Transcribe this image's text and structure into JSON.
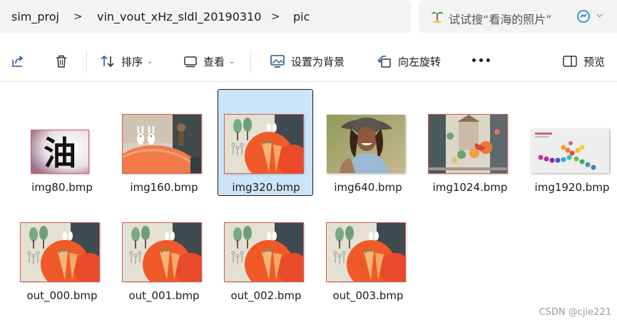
{
  "breadcrumb": {
    "items": [
      "sim_proj",
      "vin_vout_xHz_sldl_20190310",
      "pic"
    ],
    "separator": ">"
  },
  "search": {
    "placeholder": "试试搜“看海的照片”"
  },
  "toolbar": {
    "share_icon": "share-icon",
    "delete_icon": "trash-icon",
    "sort_label": "排序",
    "view_label": "查看",
    "set_background_label": "设置为背景",
    "rotate_left_label": "向左旋转",
    "more_label": "•••",
    "preview_label": "预览"
  },
  "files": [
    {
      "name": "img80.bmp",
      "kind": "oil-char"
    },
    {
      "name": "img160.bmp",
      "kind": "bunny"
    },
    {
      "name": "img320.bmp",
      "kind": "carrot",
      "selected": true
    },
    {
      "name": "img640.bmp",
      "kind": "woman"
    },
    {
      "name": "img1024.bmp",
      "kind": "scene"
    },
    {
      "name": "img1920.bmp",
      "kind": "balls"
    },
    {
      "name": "out_000.bmp",
      "kind": "carrot"
    },
    {
      "name": "out_001.bmp",
      "kind": "carrot"
    },
    {
      "name": "out_002.bmp",
      "kind": "carrot"
    },
    {
      "name": "out_003.bmp",
      "kind": "carrot"
    }
  ],
  "oil_glyph": "油",
  "watermark": "CSDN @cjie221",
  "colors": {
    "selected_bg": "#cce4f7",
    "chrome_bg": "#f3f3f3"
  }
}
